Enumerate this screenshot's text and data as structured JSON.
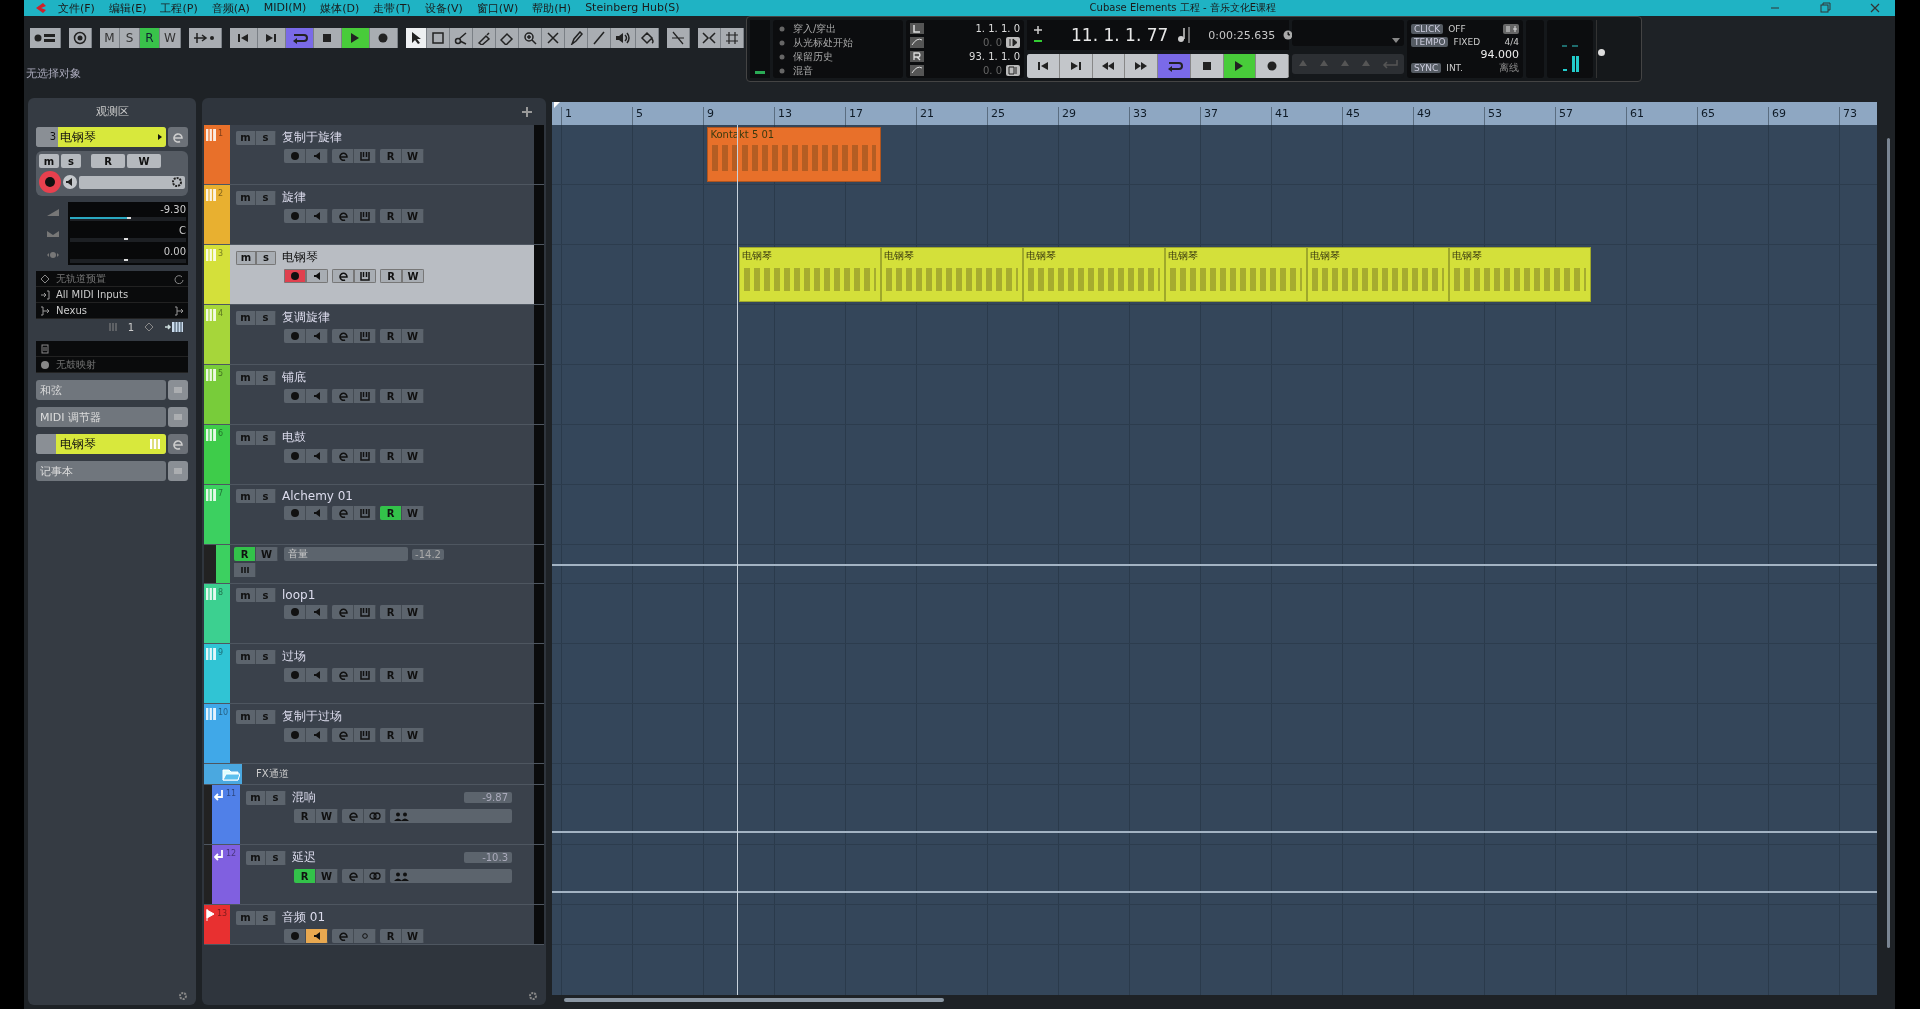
{
  "window": {
    "title": "Cubase Elements 工程 - 音乐文化E课程"
  },
  "menu": [
    "文件(F)",
    "编辑(E)",
    "工程(P)",
    "音频(A)",
    "MIDI(M)",
    "媒体(D)",
    "走带(T)",
    "设备(V)",
    "窗口(W)",
    "帮助(H)",
    "Steinberg Hub(S)"
  ],
  "toolbar": {
    "modes": [
      {
        "label": "M",
        "selected": false
      },
      {
        "label": "S",
        "selected": false
      },
      {
        "label": "R",
        "selected": true
      },
      {
        "label": "W",
        "selected": false
      }
    ],
    "transport": [
      {
        "kind": "start",
        "on": false
      },
      {
        "kind": "end",
        "on": false
      },
      {
        "kind": "cycle",
        "on": true
      },
      {
        "kind": "stop",
        "on": false
      },
      {
        "kind": "play",
        "on": true
      },
      {
        "kind": "record",
        "on": false
      }
    ],
    "tools": [
      {
        "kind": "arrow",
        "selected": true
      },
      {
        "kind": "range",
        "selected": false
      },
      {
        "kind": "scissors",
        "selected": false
      },
      {
        "kind": "glue",
        "selected": false
      },
      {
        "kind": "eraser",
        "selected": false
      },
      {
        "kind": "zoom",
        "selected": false
      },
      {
        "kind": "mute",
        "selected": false
      },
      {
        "kind": "pencil",
        "selected": false
      },
      {
        "kind": "line",
        "selected": false
      },
      {
        "kind": "speaker",
        "selected": false
      },
      {
        "kind": "paint",
        "selected": false
      }
    ],
    "status": "无选择对象"
  },
  "transport_panel": {
    "options": [
      "穿入/穿出",
      "从光标处开始",
      "保留历史",
      "混音"
    ],
    "left_locator": "1. 1. 1. 0",
    "left_offset": "0. 0",
    "right_locator": "93. 1. 1. 0",
    "right_offset": "0. 0",
    "position": "11. 1. 1. 77",
    "time": "0:00:25.635",
    "buttons": [
      {
        "kind": "start",
        "on": false
      },
      {
        "kind": "end",
        "on": false
      },
      {
        "kind": "rewind",
        "on": false
      },
      {
        "kind": "forward",
        "on": false
      },
      {
        "kind": "cycle",
        "on": true
      },
      {
        "kind": "stop",
        "on": false
      },
      {
        "kind": "play",
        "on": true
      },
      {
        "kind": "record",
        "on": false
      }
    ],
    "click": {
      "label": "CLICK",
      "value": "OFF"
    },
    "tempo": {
      "label": "TEMPO",
      "value": "FIXED",
      "signature": "4/4",
      "bpm": "94.000"
    },
    "sync": {
      "label": "SYNC",
      "value": "INT.",
      "state": "离线"
    },
    "master": {
      "level": 0.45
    }
  },
  "inspector": {
    "title": "观测区",
    "track_number": "3",
    "track_name": "电钢琴",
    "labels": [
      "m",
      "s",
      "R",
      "W"
    ],
    "record": true,
    "volume": {
      "value": "-9.30",
      "level": 0.53
    },
    "pan": {
      "value": "C",
      "level": 0.5
    },
    "delay": {
      "value": "0.00",
      "level": 0.5
    },
    "preset": "无轨道预置",
    "input": "All MIDI Inputs",
    "output": "Nexus",
    "channel": "1",
    "drum_map": "无鼓映射",
    "sections": [
      {
        "label": "和弦",
        "kind": "plain"
      },
      {
        "label": "MIDI 调节器",
        "kind": "plain"
      },
      {
        "label": "电钢琴",
        "kind": "track"
      },
      {
        "label": "记事本",
        "kind": "plain"
      }
    ]
  },
  "tracks": [
    {
      "kind": "midi",
      "number": "1",
      "name": "复制于旋律",
      "color": "#e8702a",
      "selected": false,
      "record": false,
      "read": false,
      "labels": [
        "m",
        "s",
        "R",
        "W"
      ],
      "parts": [
        {
          "label": "Kontakt 5 01"
        }
      ]
    },
    {
      "kind": "midi",
      "number": "2",
      "name": "旋律",
      "color": "#e8b030",
      "selected": false,
      "record": false,
      "read": false,
      "labels": [
        "m",
        "s",
        "R",
        "W"
      ]
    },
    {
      "kind": "midi",
      "number": "3",
      "name": "电钢琴",
      "color": "#d4e03a",
      "selected": true,
      "record": true,
      "read": false,
      "labels": [
        "m",
        "s",
        "R",
        "W"
      ],
      "parts": [
        {
          "label": "电钢琴"
        },
        {
          "label": "电钢琴"
        },
        {
          "label": "电钢琴"
        },
        {
          "label": "电钢琴"
        },
        {
          "label": "电钢琴"
        },
        {
          "label": "电钢琴"
        }
      ]
    },
    {
      "kind": "midi",
      "number": "4",
      "name": "复调旋律",
      "color": "#a6d63a",
      "selected": false,
      "record": false,
      "read": false,
      "labels": [
        "m",
        "s",
        "R",
        "W"
      ]
    },
    {
      "kind": "midi",
      "number": "5",
      "name": "铺底",
      "color": "#78cc3a",
      "selected": false,
      "record": false,
      "read": false,
      "labels": [
        "m",
        "s",
        "R",
        "W"
      ]
    },
    {
      "kind": "midi",
      "number": "6",
      "name": "电鼓",
      "color": "#3ecc4a",
      "selected": false,
      "record": false,
      "read": false,
      "labels": [
        "m",
        "s",
        "R",
        "W"
      ]
    },
    {
      "kind": "midi",
      "number": "7",
      "name": "Alchemy 01",
      "color": "#3cd060",
      "selected": false,
      "record": false,
      "read": true,
      "labels": [
        "m",
        "s",
        "R",
        "W"
      ]
    },
    {
      "kind": "automation",
      "param": "音量",
      "value": "-14.2",
      "color": "#3cd060",
      "read": true,
      "labels": [
        "R",
        "W"
      ]
    },
    {
      "kind": "midi",
      "number": "8",
      "name": "loop1",
      "color": "#3cd090",
      "selected": false,
      "record": false,
      "read": false,
      "labels": [
        "m",
        "s",
        "R",
        "W"
      ]
    },
    {
      "kind": "midi",
      "number": "9",
      "name": "过场",
      "color": "#30c4d4",
      "selected": false,
      "record": false,
      "read": false,
      "labels": [
        "m",
        "s",
        "R",
        "W"
      ]
    },
    {
      "kind": "midi",
      "number": "10",
      "name": "复制于过场",
      "color": "#40a8e8",
      "selected": false,
      "record": false,
      "read": false,
      "labels": [
        "m",
        "s",
        "R",
        "W"
      ]
    },
    {
      "kind": "folder",
      "name": "FX通道",
      "color": "#4aa8e0"
    },
    {
      "kind": "fx",
      "number": "11",
      "name": "混响",
      "color": "#5080e8",
      "selected": false,
      "read": false,
      "value": "-9.87",
      "labels": [
        "m",
        "s",
        "R",
        "W"
      ]
    },
    {
      "kind": "fx",
      "number": "12",
      "name": "延迟",
      "color": "#8060e0",
      "selected": false,
      "read": true,
      "value": "-10.3",
      "labels": [
        "m",
        "s",
        "R",
        "W"
      ]
    },
    {
      "kind": "audio",
      "number": "13",
      "name": "音频 01",
      "color": "#e83030",
      "selected": false,
      "record": false,
      "read": false,
      "monitor": true,
      "labels": [
        "m",
        "s",
        "R",
        "W"
      ]
    }
  ],
  "arrange": {
    "bars": [
      "1",
      "5",
      "9",
      "13",
      "17",
      "21",
      "25",
      "29",
      "33",
      "37",
      "41",
      "45",
      "49",
      "53",
      "57",
      "61",
      "65",
      "69",
      "73"
    ]
  }
}
